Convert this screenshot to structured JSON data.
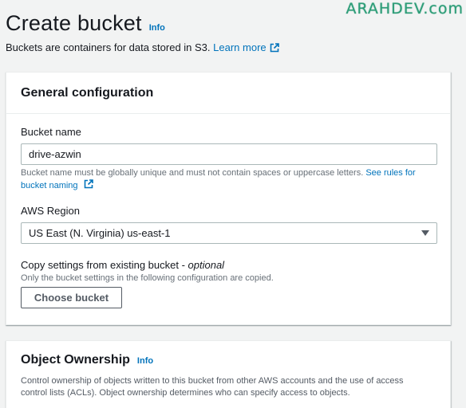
{
  "watermark": "ARAHDEV.com",
  "header": {
    "title": "Create bucket",
    "info": "Info",
    "subtitle": "Buckets are containers for data stored in S3.",
    "learn_more": "Learn more"
  },
  "general": {
    "title": "General configuration",
    "bucket_name": {
      "label": "Bucket name",
      "value": "drive-azwin",
      "hint": "Bucket name must be globally unique and must not contain spaces or uppercase letters.",
      "hint_link": "See rules for bucket naming"
    },
    "region": {
      "label": "AWS Region",
      "selected": "US East (N. Virginia) us-east-1"
    },
    "copy_settings": {
      "label": "Copy settings from existing bucket - ",
      "optional": "optional",
      "description": "Only the bucket settings in the following configuration are copied.",
      "button": "Choose bucket"
    }
  },
  "ownership": {
    "title": "Object Ownership",
    "info": "Info",
    "description": "Control ownership of objects written to this bucket from other AWS accounts and the use of access control lists (ACLs). Object ownership determines who can specify access to objects."
  },
  "colors": {
    "link": "#0073bb",
    "watermark": "#2e9d78",
    "background": "#f2f3f3"
  }
}
